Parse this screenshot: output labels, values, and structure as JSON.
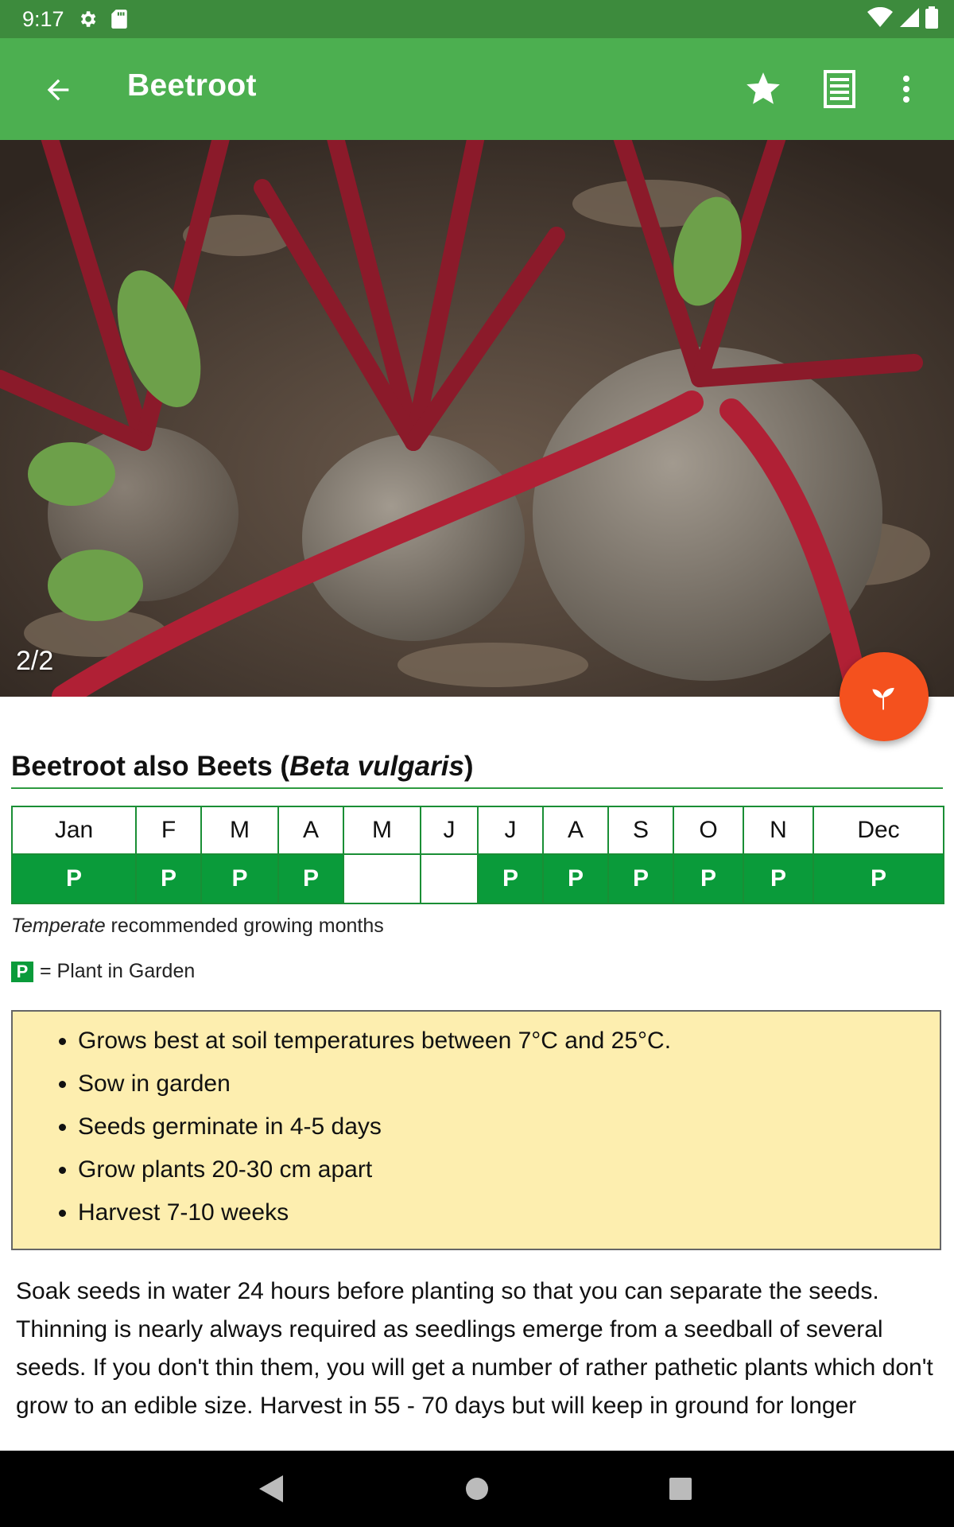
{
  "status_bar": {
    "time": "9:17",
    "icons": [
      "gear-icon",
      "sd-card-icon",
      "wifi-icon",
      "signal-icon",
      "battery-icon"
    ]
  },
  "app_bar": {
    "title": "Beetroot",
    "actions": [
      "star-icon",
      "list-icon",
      "more-vert-icon"
    ]
  },
  "hero": {
    "counter": "2/2"
  },
  "fab": {
    "icon": "sprout-icon",
    "color": "#f4511e"
  },
  "plant": {
    "common_name": "Beetroot also Beets (",
    "scientific_name": "Beta vulgaris",
    "closing": ")"
  },
  "calendar": {
    "months": [
      "Jan",
      "F",
      "M",
      "A",
      "M",
      "J",
      "J",
      "A",
      "S",
      "O",
      "N",
      "Dec"
    ],
    "planting": [
      "P",
      "P",
      "P",
      "P",
      "",
      "",
      "P",
      "P",
      "P",
      "P",
      "P",
      "P"
    ],
    "accent_color": "#0a9b3a"
  },
  "note": {
    "climate": "Temperate",
    "rest": " recommended growing months"
  },
  "legend": {
    "symbol": "P",
    "text": "= Plant in Garden"
  },
  "tips": [
    "Grows best at soil temperatures between 7°C and 25°C.",
    "Sow in garden",
    "Seeds germinate in 4-5 days",
    "Grow plants 20-30 cm apart",
    "Harvest 7-10 weeks"
  ],
  "description": "Soak seeds in water 24 hours before planting so that you can separate the seeds. Thinning is nearly always required as seedlings emerge from a seedball of several seeds. If you don't thin them, you will get a number of rather pathetic plants which don't grow to an edible size. Harvest in 55 - 70 days but will keep in ground for longer",
  "nav_bar": [
    "back-triangle-icon",
    "home-circle-icon",
    "recents-square-icon"
  ]
}
